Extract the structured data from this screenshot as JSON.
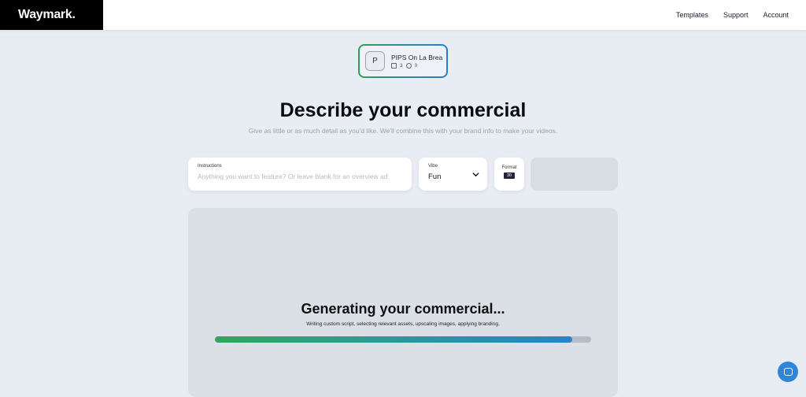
{
  "header": {
    "logo": "Waymark.",
    "nav": [
      {
        "label": "Templates"
      },
      {
        "label": "Support"
      },
      {
        "label": "Account"
      }
    ]
  },
  "brand": {
    "initial": "P",
    "name": "PIPS On La Brea",
    "images_count": "3",
    "videos_count": "0"
  },
  "main": {
    "title": "Describe your commercial",
    "subtitle": "Give as little or as much detail as you'd like. We'll combine this with your brand info to make your videos."
  },
  "form": {
    "instructions_label": "Instructions",
    "instructions_placeholder": "Anything you want to feature? Or leave blank for an overview ad",
    "instructions_value": "",
    "vibe_label": "Vibe",
    "vibe_value": "Fun",
    "format_label": "Format",
    "format_value": "30"
  },
  "generation": {
    "title": "Generating your commercial...",
    "status": "Writing custom script, selecting relevant assets, upscaling images, applying branding.",
    "progress": 0.95
  },
  "colors": {
    "brand_border_start": "#2e9d5b",
    "brand_border_end": "#2a7fc7",
    "progress_start": "#36a45f",
    "progress_end": "#2a82c9",
    "chat_bubble": "#2f86d8"
  },
  "icons": {
    "chat": "chat-icon",
    "vibe_dropdown": "chevron-down-icon"
  }
}
